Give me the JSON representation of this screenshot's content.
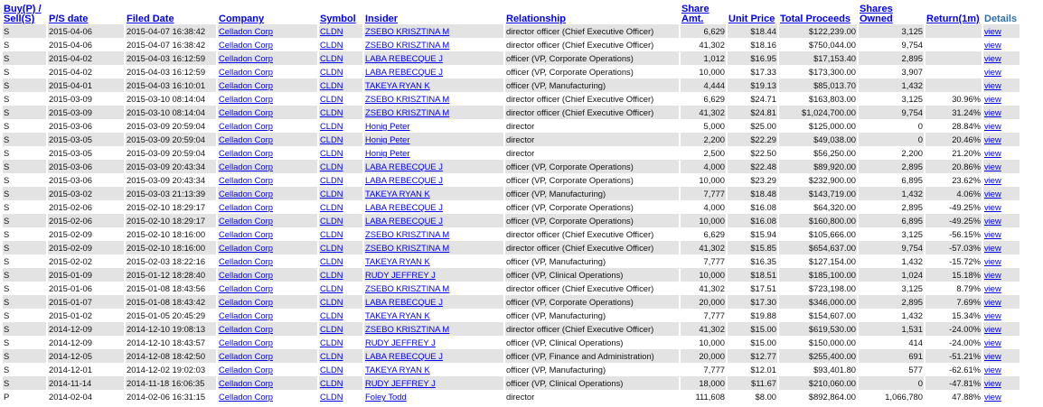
{
  "headers": {
    "buy_sell": "Buy(P) / Sell(S)",
    "ps_date": "P/S date",
    "filed_date": "Filed Date",
    "company": "Company",
    "symbol": "Symbol",
    "insider": "Insider",
    "relationship": "Relationship",
    "share_amt": "Share Amt.",
    "unit_price": "Unit Price",
    "total_proceeds": "Total Proceeds",
    "shares_owned": "Shares Owned",
    "return_1m": "Return(1m)",
    "details": "Details"
  },
  "rows": [
    {
      "type": "S",
      "ps_date": "2015-04-06",
      "filed": "2015-04-07 16:38:42",
      "company": "Celladon Corp",
      "symbol": "CLDN",
      "insider": "ZSEBO KRISZTINA M",
      "relationship": "director officer (Chief Executive Officer)",
      "amt": "6,629",
      "price": "$18.44",
      "total": "$122,239.00",
      "owned": "3,125",
      "ret": "",
      "details": "view"
    },
    {
      "type": "S",
      "ps_date": "2015-04-06",
      "filed": "2015-04-07 16:38:42",
      "company": "Celladon Corp",
      "symbol": "CLDN",
      "insider": "ZSEBO KRISZTINA M",
      "relationship": "director officer (Chief Executive Officer)",
      "amt": "41,302",
      "price": "$18.16",
      "total": "$750,044.00",
      "owned": "9,754",
      "ret": "",
      "details": "view"
    },
    {
      "type": "S",
      "ps_date": "2015-04-02",
      "filed": "2015-04-03 16:12:59",
      "company": "Celladon Corp",
      "symbol": "CLDN",
      "insider": "LABA REBECQUE J",
      "relationship": "officer (VP, Corporate Operations)",
      "amt": "1,012",
      "price": "$16.95",
      "total": "$17,153.40",
      "owned": "2,895",
      "ret": "",
      "details": "view"
    },
    {
      "type": "S",
      "ps_date": "2015-04-02",
      "filed": "2015-04-03 16:12:59",
      "company": "Celladon Corp",
      "symbol": "CLDN",
      "insider": "LABA REBECQUE J",
      "relationship": "officer (VP, Corporate Operations)",
      "amt": "10,000",
      "price": "$17.33",
      "total": "$173,300.00",
      "owned": "3,907",
      "ret": "",
      "details": "view"
    },
    {
      "type": "S",
      "ps_date": "2015-04-01",
      "filed": "2015-04-03 16:10:01",
      "company": "Celladon Corp",
      "symbol": "CLDN",
      "insider": "TAKEYA RYAN K",
      "relationship": "officer (VP, Manufacturing)",
      "amt": "4,444",
      "price": "$19.13",
      "total": "$85,013.70",
      "owned": "1,432",
      "ret": "",
      "details": "view"
    },
    {
      "type": "S",
      "ps_date": "2015-03-09",
      "filed": "2015-03-10 08:14:04",
      "company": "Celladon Corp",
      "symbol": "CLDN",
      "insider": "ZSEBO KRISZTINA M",
      "relationship": "director officer (Chief Executive Officer)",
      "amt": "6,629",
      "price": "$24.71",
      "total": "$163,803.00",
      "owned": "3,125",
      "ret": "30.96%",
      "details": "view"
    },
    {
      "type": "S",
      "ps_date": "2015-03-09",
      "filed": "2015-03-10 08:14:04",
      "company": "Celladon Corp",
      "symbol": "CLDN",
      "insider": "ZSEBO KRISZTINA M",
      "relationship": "director officer (Chief Executive Officer)",
      "amt": "41,302",
      "price": "$24.81",
      "total": "$1,024,700.00",
      "owned": "9,754",
      "ret": "31.24%",
      "details": "view"
    },
    {
      "type": "S",
      "ps_date": "2015-03-06",
      "filed": "2015-03-09 20:59:04",
      "company": "Celladon Corp",
      "symbol": "CLDN",
      "insider": "Honig Peter",
      "relationship": "director",
      "amt": "5,000",
      "price": "$25.00",
      "total": "$125,000.00",
      "owned": "0",
      "ret": "28.84%",
      "details": "view"
    },
    {
      "type": "S",
      "ps_date": "2015-03-05",
      "filed": "2015-03-09 20:59:04",
      "company": "Celladon Corp",
      "symbol": "CLDN",
      "insider": "Honig Peter",
      "relationship": "director",
      "amt": "2,200",
      "price": "$22.29",
      "total": "$49,038.00",
      "owned": "0",
      "ret": "20.46%",
      "details": "view"
    },
    {
      "type": "S",
      "ps_date": "2015-03-05",
      "filed": "2015-03-09 20:59:04",
      "company": "Celladon Corp",
      "symbol": "CLDN",
      "insider": "Honig Peter",
      "relationship": "director",
      "amt": "2,500",
      "price": "$22.50",
      "total": "$56,250.00",
      "owned": "2,200",
      "ret": "21.20%",
      "details": "view"
    },
    {
      "type": "S",
      "ps_date": "2015-03-06",
      "filed": "2015-03-09 20:43:34",
      "company": "Celladon Corp",
      "symbol": "CLDN",
      "insider": "LABA REBECQUE J",
      "relationship": "officer (VP, Corporate Operations)",
      "amt": "4,000",
      "price": "$22.48",
      "total": "$89,920.00",
      "owned": "2,895",
      "ret": "20.86%",
      "details": "view"
    },
    {
      "type": "S",
      "ps_date": "2015-03-06",
      "filed": "2015-03-09 20:43:34",
      "company": "Celladon Corp",
      "symbol": "CLDN",
      "insider": "LABA REBECQUE J",
      "relationship": "officer (VP, Corporate Operations)",
      "amt": "10,000",
      "price": "$23.29",
      "total": "$232,900.00",
      "owned": "6,895",
      "ret": "23.62%",
      "details": "view"
    },
    {
      "type": "S",
      "ps_date": "2015-03-02",
      "filed": "2015-03-03 21:13:39",
      "company": "Celladon Corp",
      "symbol": "CLDN",
      "insider": "TAKEYA RYAN K",
      "relationship": "officer (VP, Manufacturing)",
      "amt": "7,777",
      "price": "$18.48",
      "total": "$143,719.00",
      "owned": "1,432",
      "ret": "4.06%",
      "details": "view"
    },
    {
      "type": "S",
      "ps_date": "2015-02-06",
      "filed": "2015-02-10 18:29:17",
      "company": "Celladon Corp",
      "symbol": "CLDN",
      "insider": "LABA REBECQUE J",
      "relationship": "officer (VP, Corporate Operations)",
      "amt": "4,000",
      "price": "$16.08",
      "total": "$64,320.00",
      "owned": "2,895",
      "ret": "-49.25%",
      "details": "view"
    },
    {
      "type": "S",
      "ps_date": "2015-02-06",
      "filed": "2015-02-10 18:29:17",
      "company": "Celladon Corp",
      "symbol": "CLDN",
      "insider": "LABA REBECQUE J",
      "relationship": "officer (VP, Corporate Operations)",
      "amt": "10,000",
      "price": "$16.08",
      "total": "$160,800.00",
      "owned": "6,895",
      "ret": "-49.25%",
      "details": "view"
    },
    {
      "type": "S",
      "ps_date": "2015-02-09",
      "filed": "2015-02-10 18:16:00",
      "company": "Celladon Corp",
      "symbol": "CLDN",
      "insider": "ZSEBO KRISZTINA M",
      "relationship": "director officer (Chief Executive Officer)",
      "amt": "6,629",
      "price": "$15.94",
      "total": "$105,666.00",
      "owned": "3,125",
      "ret": "-56.15%",
      "details": "view"
    },
    {
      "type": "S",
      "ps_date": "2015-02-09",
      "filed": "2015-02-10 18:16:00",
      "company": "Celladon Corp",
      "symbol": "CLDN",
      "insider": "ZSEBO KRISZTINA M",
      "relationship": "director officer (Chief Executive Officer)",
      "amt": "41,302",
      "price": "$15.85",
      "total": "$654,637.00",
      "owned": "9,754",
      "ret": "-57.03%",
      "details": "view"
    },
    {
      "type": "S",
      "ps_date": "2015-02-02",
      "filed": "2015-02-03 18:22:16",
      "company": "Celladon Corp",
      "symbol": "CLDN",
      "insider": "TAKEYA RYAN K",
      "relationship": "officer (VP, Manufacturing)",
      "amt": "7,777",
      "price": "$16.35",
      "total": "$127,154.00",
      "owned": "1,432",
      "ret": "-15.72%",
      "details": "view"
    },
    {
      "type": "S",
      "ps_date": "2015-01-09",
      "filed": "2015-01-12 18:28:40",
      "company": "Celladon Corp",
      "symbol": "CLDN",
      "insider": "RUDY JEFFREY J",
      "relationship": "officer (VP, Clinical Operations)",
      "amt": "10,000",
      "price": "$18.51",
      "total": "$185,100.00",
      "owned": "1,024",
      "ret": "15.18%",
      "details": "view"
    },
    {
      "type": "S",
      "ps_date": "2015-01-06",
      "filed": "2015-01-08 18:43:56",
      "company": "Celladon Corp",
      "symbol": "CLDN",
      "insider": "ZSEBO KRISZTINA M",
      "relationship": "director officer (Chief Executive Officer)",
      "amt": "41,302",
      "price": "$17.51",
      "total": "$723,198.00",
      "owned": "3,125",
      "ret": "8.79%",
      "details": "view"
    },
    {
      "type": "S",
      "ps_date": "2015-01-07",
      "filed": "2015-01-08 18:43:42",
      "company": "Celladon Corp",
      "symbol": "CLDN",
      "insider": "LABA REBECQUE J",
      "relationship": "officer (VP, Corporate Operations)",
      "amt": "20,000",
      "price": "$17.30",
      "total": "$346,000.00",
      "owned": "2,895",
      "ret": "7.69%",
      "details": "view"
    },
    {
      "type": "S",
      "ps_date": "2015-01-02",
      "filed": "2015-01-05 20:45:29",
      "company": "Celladon Corp",
      "symbol": "CLDN",
      "insider": "TAKEYA RYAN K",
      "relationship": "officer (VP, Manufacturing)",
      "amt": "7,777",
      "price": "$19.88",
      "total": "$154,607.00",
      "owned": "1,432",
      "ret": "15.34%",
      "details": "view"
    },
    {
      "type": "S",
      "ps_date": "2014-12-09",
      "filed": "2014-12-10 19:08:13",
      "company": "Celladon Corp",
      "symbol": "CLDN",
      "insider": "ZSEBO KRISZTINA M",
      "relationship": "director officer (Chief Executive Officer)",
      "amt": "41,302",
      "price": "$15.00",
      "total": "$619,530.00",
      "owned": "1,531",
      "ret": "-24.00%",
      "details": "view"
    },
    {
      "type": "S",
      "ps_date": "2014-12-09",
      "filed": "2014-12-10 18:43:57",
      "company": "Celladon Corp",
      "symbol": "CLDN",
      "insider": "RUDY JEFFREY J",
      "relationship": "officer (VP, Clinical Operations)",
      "amt": "10,000",
      "price": "$15.00",
      "total": "$150,000.00",
      "owned": "414",
      "ret": "-24.00%",
      "details": "view"
    },
    {
      "type": "S",
      "ps_date": "2014-12-05",
      "filed": "2014-12-08 18:42:50",
      "company": "Celladon Corp",
      "symbol": "CLDN",
      "insider": "LABA REBECQUE J",
      "relationship": "officer (VP, Finance and Administration)",
      "amt": "20,000",
      "price": "$12.77",
      "total": "$255,400.00",
      "owned": "691",
      "ret": "-51.21%",
      "details": "view"
    },
    {
      "type": "S",
      "ps_date": "2014-12-01",
      "filed": "2014-12-02 19:02:03",
      "company": "Celladon Corp",
      "symbol": "CLDN",
      "insider": "TAKEYA RYAN K",
      "relationship": "officer (VP, Manufacturing)",
      "amt": "7,777",
      "price": "$12.01",
      "total": "$93,401.80",
      "owned": "577",
      "ret": "-62.61%",
      "details": "view"
    },
    {
      "type": "S",
      "ps_date": "2014-11-14",
      "filed": "2014-11-18 16:06:35",
      "company": "Celladon Corp",
      "symbol": "CLDN",
      "insider": "RUDY JEFFREY J",
      "relationship": "officer (VP, Clinical Operations)",
      "amt": "18,000",
      "price": "$11.67",
      "total": "$210,060.00",
      "owned": "0",
      "ret": "-47.81%",
      "details": "view"
    },
    {
      "type": "P",
      "ps_date": "2014-02-04",
      "filed": "2014-02-06 16:31:15",
      "company": "Celladon Corp",
      "symbol": "CLDN",
      "insider": "Foley Todd",
      "relationship": "director",
      "amt": "111,608",
      "price": "$8.00",
      "total": "$892,864.00",
      "owned": "1,066,780",
      "ret": "47.88%",
      "details": "view"
    }
  ]
}
